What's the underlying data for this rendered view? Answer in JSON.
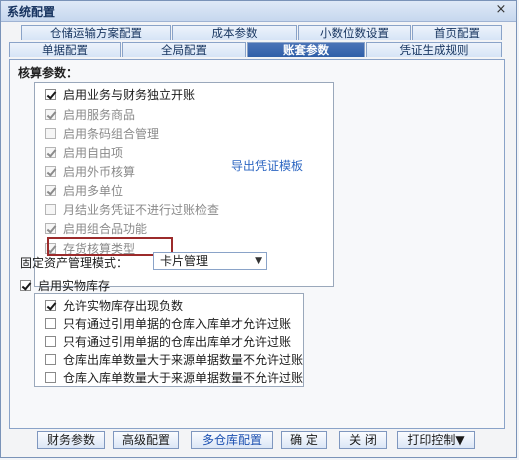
{
  "window": {
    "title": "系统配置",
    "close_glyph": "×"
  },
  "tabs": {
    "row1": [
      "仓储运输方案配置",
      "成本参数",
      "小数位数设置",
      "首页配置"
    ],
    "row2": [
      "单据配置",
      "全局配置",
      "账套参数",
      "凭证生成规则"
    ],
    "active": "账套参数"
  },
  "accounting": {
    "section_label": "核算参数：",
    "export_link": "导出凭证模板",
    "options": [
      {
        "label": "启用业务与财务独立开账",
        "checked": true,
        "enabled": true
      },
      {
        "label": "启用服务商品",
        "checked": true,
        "enabled": false
      },
      {
        "label": "启用条码组合管理",
        "checked": false,
        "enabled": false
      },
      {
        "label": "启用自由项",
        "checked": true,
        "enabled": false
      },
      {
        "label": "启用外币核算",
        "checked": true,
        "enabled": false
      },
      {
        "label": "启用多单位",
        "checked": true,
        "enabled": false
      },
      {
        "label": "月结业务凭证不进行过账检查",
        "checked": false,
        "enabled": false
      },
      {
        "label": "启用组合品功能",
        "checked": true,
        "enabled": false
      },
      {
        "label": "存货核算类型",
        "checked": true,
        "enabled": false
      }
    ]
  },
  "fixed_asset": {
    "label": "固定资产管理模式：",
    "value": "卡片管理"
  },
  "inventory": {
    "label": "启用实物库存",
    "checked": true,
    "options": [
      {
        "label": "允许实物库存出现负数",
        "checked": true
      },
      {
        "label": "只有通过引用单据的仓库入库单才允许过账",
        "checked": false
      },
      {
        "label": "只有通过引用单据的仓库出库单才允许过账",
        "checked": false
      },
      {
        "label": "仓库出库单数量大于来源单据数量不允许过账",
        "checked": false
      },
      {
        "label": "仓库入库单数量大于来源单据数量不允许过账",
        "checked": false
      }
    ]
  },
  "buttons": {
    "finance": "财务参数",
    "advanced": "高级配置",
    "multi_warehouse": "多仓库配置",
    "ok": "确 定",
    "close": "关 闭",
    "print": "打印控制▼"
  }
}
